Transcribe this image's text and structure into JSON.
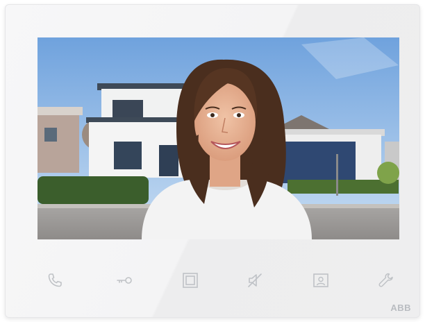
{
  "device": {
    "brand": "ABB"
  },
  "screen": {
    "content": "video-feed",
    "colors": {
      "sky": "#8fb8e6",
      "house": "#f1f2f2",
      "garage": "#2f4872",
      "hedge": "#3b5e2c",
      "hair": "#4a2e1e",
      "shirt": "#f3f3f3"
    }
  },
  "controls": [
    {
      "name": "phone-icon",
      "id": "call"
    },
    {
      "name": "key-icon",
      "id": "unlock"
    },
    {
      "name": "square-frame-icon",
      "id": "home"
    },
    {
      "name": "mute-icon",
      "id": "mute"
    },
    {
      "name": "portrait-icon",
      "id": "surveillance"
    },
    {
      "name": "wrench-icon",
      "id": "settings"
    }
  ],
  "colors": {
    "icon": "#bfc2c6",
    "bezel": "#f5f5f6"
  }
}
